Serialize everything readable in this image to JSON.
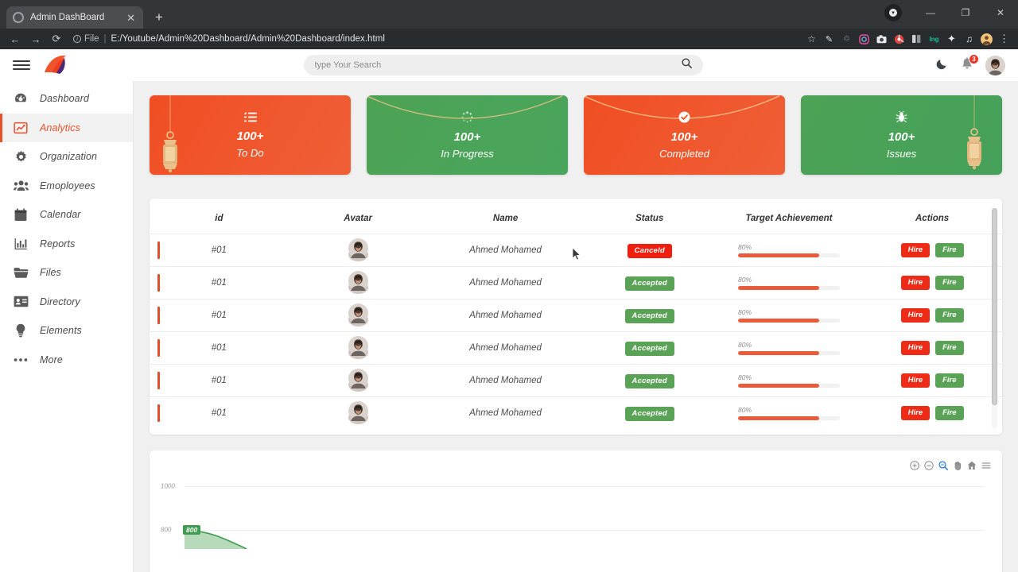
{
  "browser": {
    "tab": {
      "title": "Admin DashBoard",
      "close": "✕",
      "favicon": "globe-icon"
    },
    "newtab_label": "+",
    "nav": {
      "back": "←",
      "forward": "→",
      "reload": "⟳"
    },
    "omnibox": {
      "scheme_label": "File",
      "url": "E:/Youtube/Admin%20Dashboard/Admin%20Dashboard/index.html",
      "separator": "|"
    },
    "window": {
      "minimize": "—",
      "maximize": "❐",
      "close": "✕"
    },
    "extensions": [
      "bookmark-star-icon",
      "pen-icon",
      "recycle-icon",
      "instagram-icon",
      "camera-icon",
      "colorpicker-icon",
      "split-icon",
      "grammarly-icon",
      "puzzle-icon",
      "readlist-icon",
      "profile-icon",
      "menu-icon"
    ]
  },
  "header": {
    "menu_icon": "hamburger-icon",
    "logo_name": "app-logo",
    "search": {
      "placeholder": "type Your Search",
      "value": "",
      "icon": "search-icon"
    },
    "theme_toggle": "moon-icon",
    "notifications": {
      "icon": "bell-icon",
      "count": "3"
    },
    "avatar": "user-avatar"
  },
  "sidebar": {
    "items": [
      {
        "label": "Dashboard",
        "icon": "speedometer-icon",
        "active": false
      },
      {
        "label": "Analytics",
        "icon": "chart-line-icon",
        "active": true
      },
      {
        "label": "Organization",
        "icon": "gear-icon",
        "active": false
      },
      {
        "label": "Emoployees",
        "icon": "users-icon",
        "active": false
      },
      {
        "label": "Calendar",
        "icon": "calendar-icon",
        "active": false
      },
      {
        "label": "Reports",
        "icon": "bar-chart-icon",
        "active": false
      },
      {
        "label": "Files",
        "icon": "folder-icon",
        "active": false
      },
      {
        "label": "Directory",
        "icon": "id-card-icon",
        "active": false
      },
      {
        "label": "Elements",
        "icon": "lightbulb-icon",
        "active": false
      },
      {
        "label": "More",
        "icon": "ellipsis-icon",
        "active": false
      }
    ]
  },
  "cards": [
    {
      "value": "100+",
      "label": "To Do",
      "icon": "list-icon",
      "color": "#f04e23",
      "deco": "lantern-left"
    },
    {
      "value": "100+",
      "label": "In Progress",
      "icon": "spinner-icon",
      "color": "#4ca355",
      "deco": "arc"
    },
    {
      "value": "100+",
      "label": "Completed",
      "icon": "check-icon",
      "color": "#f04e23",
      "deco": "arc"
    },
    {
      "value": "100+",
      "label": "Issues",
      "icon": "bug-icon",
      "color": "#4ca355",
      "deco": "lantern-right"
    }
  ],
  "table": {
    "columns": [
      "id",
      "Avatar",
      "Name",
      "Status",
      "Target Achievement",
      "Actions"
    ],
    "rows": [
      {
        "id": "#01",
        "avatar": "user-avatar",
        "name": "Ahmed Mohamed",
        "status": "Canceld",
        "status_kind": "canceld",
        "target": "80%",
        "target_value": 80,
        "actions": [
          "Hire",
          "Fire"
        ]
      },
      {
        "id": "#01",
        "avatar": "user-avatar",
        "name": "Ahmed Mohamed",
        "status": "Accepted",
        "status_kind": "accepted",
        "target": "80%",
        "target_value": 80,
        "actions": [
          "Hire",
          "Fire"
        ]
      },
      {
        "id": "#01",
        "avatar": "user-avatar",
        "name": "Ahmed Mohamed",
        "status": "Accepted",
        "status_kind": "accepted",
        "target": "80%",
        "target_value": 80,
        "actions": [
          "Hire",
          "Fire"
        ]
      },
      {
        "id": "#01",
        "avatar": "user-avatar",
        "name": "Ahmed Mohamed",
        "status": "Accepted",
        "status_kind": "accepted",
        "target": "80%",
        "target_value": 80,
        "actions": [
          "Hire",
          "Fire"
        ]
      },
      {
        "id": "#01",
        "avatar": "user-avatar",
        "name": "Ahmed Mohamed",
        "status": "Accepted",
        "status_kind": "accepted",
        "target": "80%",
        "target_value": 80,
        "actions": [
          "Hire",
          "Fire"
        ]
      },
      {
        "id": "#01",
        "avatar": "user-avatar",
        "name": "Ahmed Mohamed",
        "status": "Accepted",
        "status_kind": "accepted",
        "target": "80%",
        "target_value": 80,
        "actions": [
          "Hire",
          "Fire"
        ]
      }
    ],
    "scrollbar": "vertical-scrollbar"
  },
  "chart_panel": {
    "toolbar": [
      {
        "name": "zoom-in-icon",
        "glyph": "⊕",
        "active": false
      },
      {
        "name": "zoom-out-icon",
        "glyph": "⊖",
        "active": false
      },
      {
        "name": "selection-zoom-icon",
        "glyph": "⌕",
        "active": true
      },
      {
        "name": "pan-icon",
        "glyph": "✋",
        "active": false
      },
      {
        "name": "reset-zoom-icon",
        "glyph": "⌂",
        "active": false
      },
      {
        "name": "menu-icon",
        "glyph": "☰",
        "active": false
      }
    ]
  },
  "chart_data": {
    "type": "area",
    "title": "",
    "xlabel": "",
    "ylabel": "",
    "ylim": [
      0,
      1000
    ],
    "yticks": [
      "1000",
      "800"
    ],
    "grid": true,
    "legend": "none",
    "annotations": [
      {
        "text": "800",
        "color": "#3f9c52"
      }
    ],
    "series": [
      {
        "name": "series-1",
        "color": "#4ca355",
        "values": [
          800
        ]
      }
    ]
  },
  "cursor": "mouse-pointer"
}
